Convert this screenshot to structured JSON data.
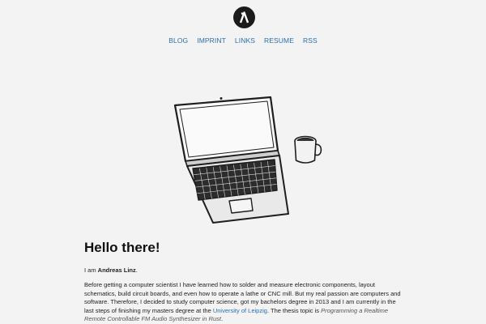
{
  "header": {
    "logo_icon": "lambda-logo-icon"
  },
  "nav": {
    "items": [
      {
        "label": "BLOG"
      },
      {
        "label": "IMPRINT"
      },
      {
        "label": "LINKS"
      },
      {
        "label": "RESUME"
      },
      {
        "label": "RSS"
      }
    ]
  },
  "hero": {
    "illustration": "laptop-and-coffee-mug-sketch"
  },
  "content": {
    "headline": "Hello there!",
    "intro_prefix": "I am ",
    "intro_name": "Andreas Linz",
    "intro_suffix": ".",
    "bio_text_1": "Before getting a computer scientist I have learned how to solder and measure electronic components, layout schematics, build circuit boards, and even how to operate a lathe or CNC mill. But my real passion are computers and software. Therefore, I decided to study computer science, got my bachelors degree in 2013 and I am currently in the last steps of finishing my masters degree at the ",
    "university_link": "University of Leipzig",
    "bio_text_2": ". The thesis topic is ",
    "thesis_title": "Programming a Realtime Remote Controllable FM Audio Synthesizer in Rust",
    "bio_text_3": "."
  },
  "colors": {
    "background": "#f3f3f3",
    "link": "#2a6fb0",
    "text": "#222222",
    "logo_bg": "#1b1b1b"
  }
}
